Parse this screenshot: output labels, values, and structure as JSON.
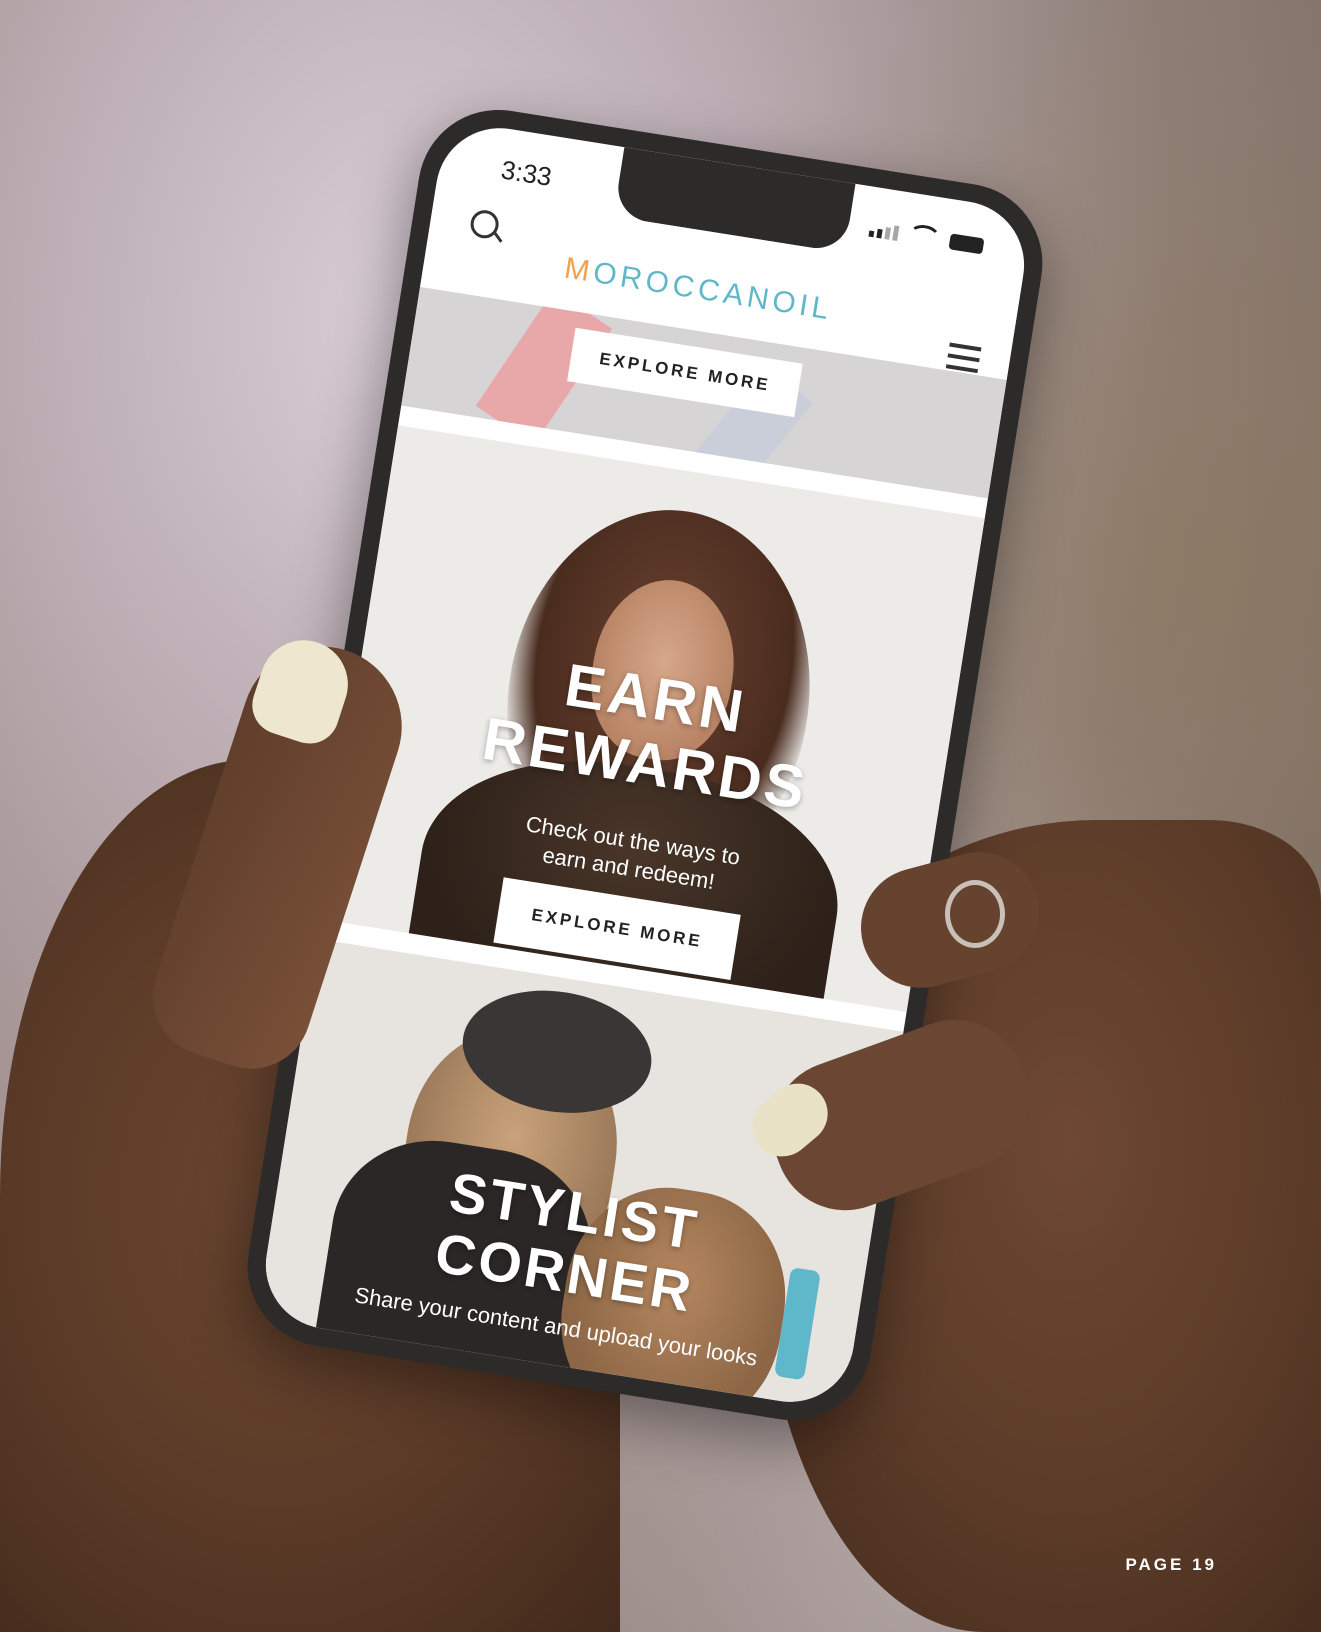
{
  "status_bar": {
    "time": "3:33"
  },
  "header": {
    "logo_first": "M",
    "logo_rest": "OROCCANOIL"
  },
  "banner_top": {
    "button_label": "EXPLORE MORE"
  },
  "rewards": {
    "title_line1": "EARN",
    "title_line2": "REWARDS",
    "subtitle_line1": "Check out the ways to",
    "subtitle_line2": "earn and redeem!",
    "button_label": "EXPLORE MORE"
  },
  "stylist": {
    "title_line1": "STYLIST",
    "title_line2": "CORNER",
    "subtitle": "Share your content and upload your looks"
  },
  "page_number": "PAGE 19",
  "colors": {
    "logo_teal": "#5fb8c9",
    "logo_orange": "#f1a24a"
  }
}
